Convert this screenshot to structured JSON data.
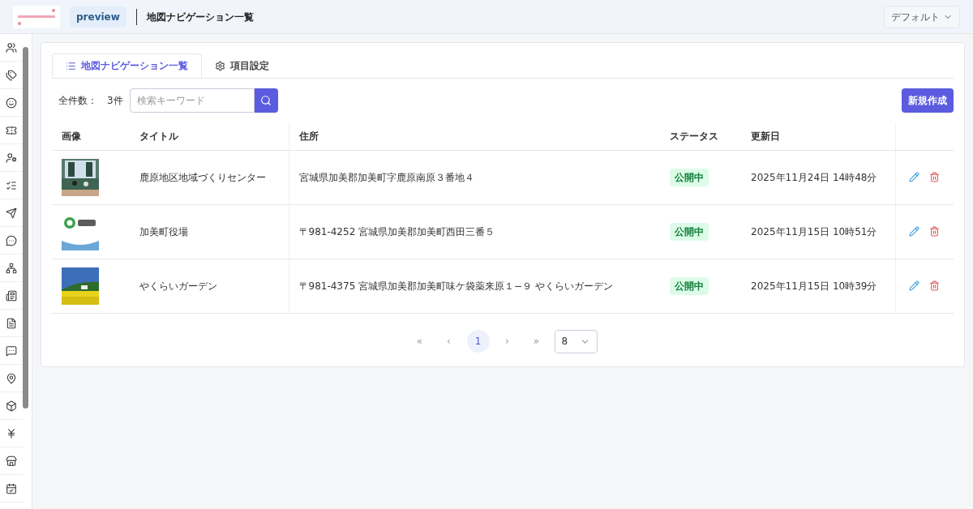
{
  "header": {
    "badge": "preview",
    "title": "地図ナビゲーション一覧",
    "view_select": "デフォルト"
  },
  "tabs": [
    {
      "label": "地図ナビゲーション一覧",
      "selected": true
    },
    {
      "label": "項目設定",
      "selected": false
    }
  ],
  "toolbar": {
    "count_label": "全件数：",
    "count": "3件",
    "search_placeholder": "検索キーワード",
    "create_button": "新規作成"
  },
  "table": {
    "columns": [
      "画像",
      "タイトル",
      "住所",
      "ステータス",
      "更新日"
    ],
    "rows": [
      {
        "title": "鹿原地区地域づくりセンター",
        "address": "宮城県加美郡加美町字鹿原南原３番地４",
        "status": {
          "label": "公開中",
          "kind": "published"
        },
        "updated": "2025年11月24日 14時48分"
      },
      {
        "title": "加美町役場",
        "address": "〒981-4252 宮城県加美郡加美町西田三番５",
        "status": {
          "label": "公開中",
          "kind": "published"
        },
        "updated": "2025年11月15日 10時51分"
      },
      {
        "title": "やくらいガーデン",
        "address": "〒981-4375 宮城県加美郡加美町味ケ袋薬来原１−９ やくらいガーデン",
        "status": {
          "label": "公開中",
          "kind": "published"
        },
        "updated": "2025年11月15日 10時39分"
      }
    ]
  },
  "pagination": {
    "first": "«",
    "prev": "‹",
    "pages": [
      {
        "label": "1",
        "selected": true
      }
    ],
    "next": "›",
    "last": "»",
    "page_size": "8"
  }
}
